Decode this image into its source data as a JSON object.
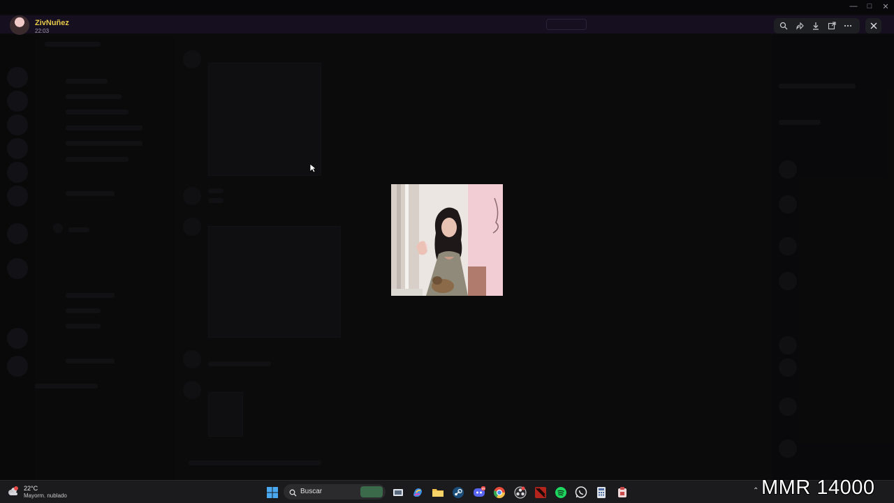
{
  "uploader": {
    "name": "ZivNuñez",
    "time": "22:03"
  },
  "viewer_toolbar": {
    "buttons": [
      {
        "icon": "zoom-icon"
      },
      {
        "icon": "forward-icon"
      },
      {
        "icon": "download-icon"
      },
      {
        "icon": "open-external-icon"
      },
      {
        "icon": "more-options-icon"
      }
    ],
    "close_icon": "close-icon"
  },
  "image_preview": {
    "icon": "photo-preview"
  },
  "taskbar": {
    "weather": {
      "temperature": "22°C",
      "description": "Mayorm. nublado"
    },
    "search": {
      "label": "Buscar"
    },
    "apps": [
      "windows-start-icon",
      "task-view-icon",
      "copilot-icon",
      "file-explorer-icon",
      "steam-icon",
      "discord-icon",
      "chrome-icon",
      "obs-icon",
      "dota-icon",
      "spotify-icon",
      "whatsapp-icon",
      "calculator-icon",
      "app-icon"
    ],
    "discord_badge": "99"
  },
  "overlay": {
    "text": "MMR 14000"
  },
  "colors": {
    "uploader_name": "#e6c84a",
    "taskbar_bg": "#1b1b1d",
    "overlay_text": "#ffffff"
  }
}
